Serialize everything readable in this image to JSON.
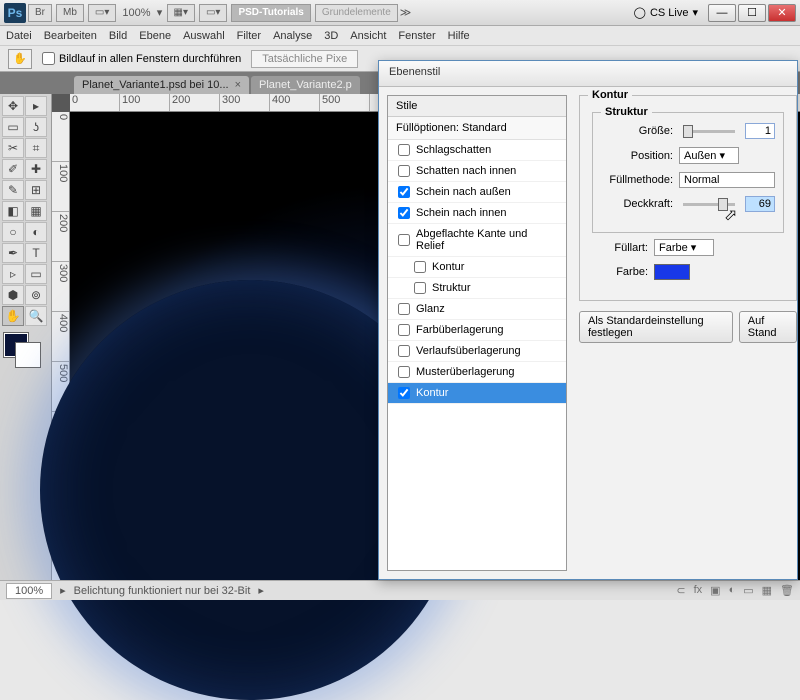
{
  "titlebar": {
    "ps": "Ps",
    "br": "Br",
    "mb": "Mb",
    "zoom": "100%",
    "tab_psd": "PSD-Tutorials",
    "tab_grund": "Grundelemente",
    "cslive": "CS Live"
  },
  "menu": [
    "Datei",
    "Bearbeiten",
    "Bild",
    "Ebene",
    "Auswahl",
    "Filter",
    "Analyse",
    "3D",
    "Ansicht",
    "Fenster",
    "Hilfe"
  ],
  "optbar": {
    "scroll_all": "Bildlauf in allen Fenstern durchführen",
    "actual": "Tatsächliche Pixe"
  },
  "tabs": {
    "t1": "Planet_Variante1.psd bei 10...",
    "t2": "Planet_Variante2.p"
  },
  "tools": [
    "▭",
    "⬚",
    "⊞",
    "⤢",
    "✎",
    "✂",
    "✉",
    "▭",
    "⌂",
    "≡",
    "✿",
    "⬡"
  ],
  "statusbar": {
    "zoom": "100%",
    "msg": "Belichtung funktioniert nur bei 32-Bit"
  },
  "dialog": {
    "title": "Ebenenstil",
    "left_hdr": "Stile",
    "fillopt": "Füllöptionen: Standard",
    "styles": [
      {
        "label": "Schlagschatten",
        "checked": false,
        "indent": false,
        "sel": false
      },
      {
        "label": "Schatten nach innen",
        "checked": false,
        "indent": false,
        "sel": false
      },
      {
        "label": "Schein nach außen",
        "checked": true,
        "indent": false,
        "sel": false
      },
      {
        "label": "Schein nach innen",
        "checked": true,
        "indent": false,
        "sel": false
      },
      {
        "label": "Abgeflachte Kante und Relief",
        "checked": false,
        "indent": false,
        "sel": false
      },
      {
        "label": "Kontur",
        "checked": false,
        "indent": true,
        "sel": false
      },
      {
        "label": "Struktur",
        "checked": false,
        "indent": true,
        "sel": false
      },
      {
        "label": "Glanz",
        "checked": false,
        "indent": false,
        "sel": false
      },
      {
        "label": "Farbüberlagerung",
        "checked": false,
        "indent": false,
        "sel": false
      },
      {
        "label": "Verlaufsüberlagerung",
        "checked": false,
        "indent": false,
        "sel": false
      },
      {
        "label": "Musterüberlagerung",
        "checked": false,
        "indent": false,
        "sel": false
      },
      {
        "label": "Kontur",
        "checked": true,
        "indent": false,
        "sel": true
      }
    ],
    "right": {
      "section": "Kontur",
      "struct": "Struktur",
      "size_lbl": "Größe:",
      "size_val": "1",
      "pos_lbl": "Position:",
      "pos_val": "Außen",
      "blend_lbl": "Füllmethode:",
      "blend_val": "Normal",
      "opac_lbl": "Deckkraft:",
      "opac_val": "69",
      "filltype_lbl": "Füllart:",
      "filltype_val": "Farbe",
      "color_lbl": "Farbe:",
      "color_val": "#1838e8",
      "btn_default": "Als Standardeinstellung festlegen",
      "btn_reset": "Auf Stand"
    }
  }
}
